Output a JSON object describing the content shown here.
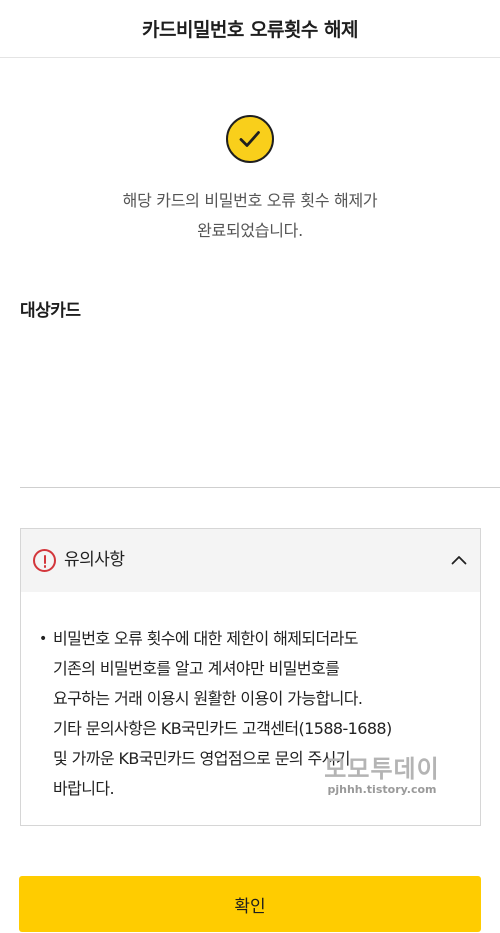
{
  "header": {
    "title": "카드비밀번호 오류횟수 해제"
  },
  "result": {
    "icon": "check-circle-icon",
    "message_line1": "해당 카드의 비밀번호 오류 횟수 해제가",
    "message_line2": "완료되었습니다."
  },
  "target_card": {
    "label": "대상카드"
  },
  "notice": {
    "icon": "info-icon",
    "title": "유의사항",
    "toggle_icon": "chevron-up-icon",
    "bullet": "•",
    "lines": [
      "비밀번호 오류 횟수에 대한 제한이 해제되더라도",
      "기존의 비밀번호를 알고 계셔야만 비밀번호를",
      "요구하는 거래 이용시 원활한 이용이 가능합니다.",
      "기타 문의사항은 KB국민카드 고객센터(1588-1688)",
      "및 가까운 KB국민카드 영업점으로 문의 주시기",
      "바랍니다."
    ]
  },
  "watermark": {
    "main": "모모투데이",
    "sub": "pjhhh.tistory.com"
  },
  "footer": {
    "confirm_label": "확인"
  },
  "colors": {
    "accent": "#ffcc00",
    "check_circle": "#f9cf1b",
    "info_red": "#d3363b"
  }
}
